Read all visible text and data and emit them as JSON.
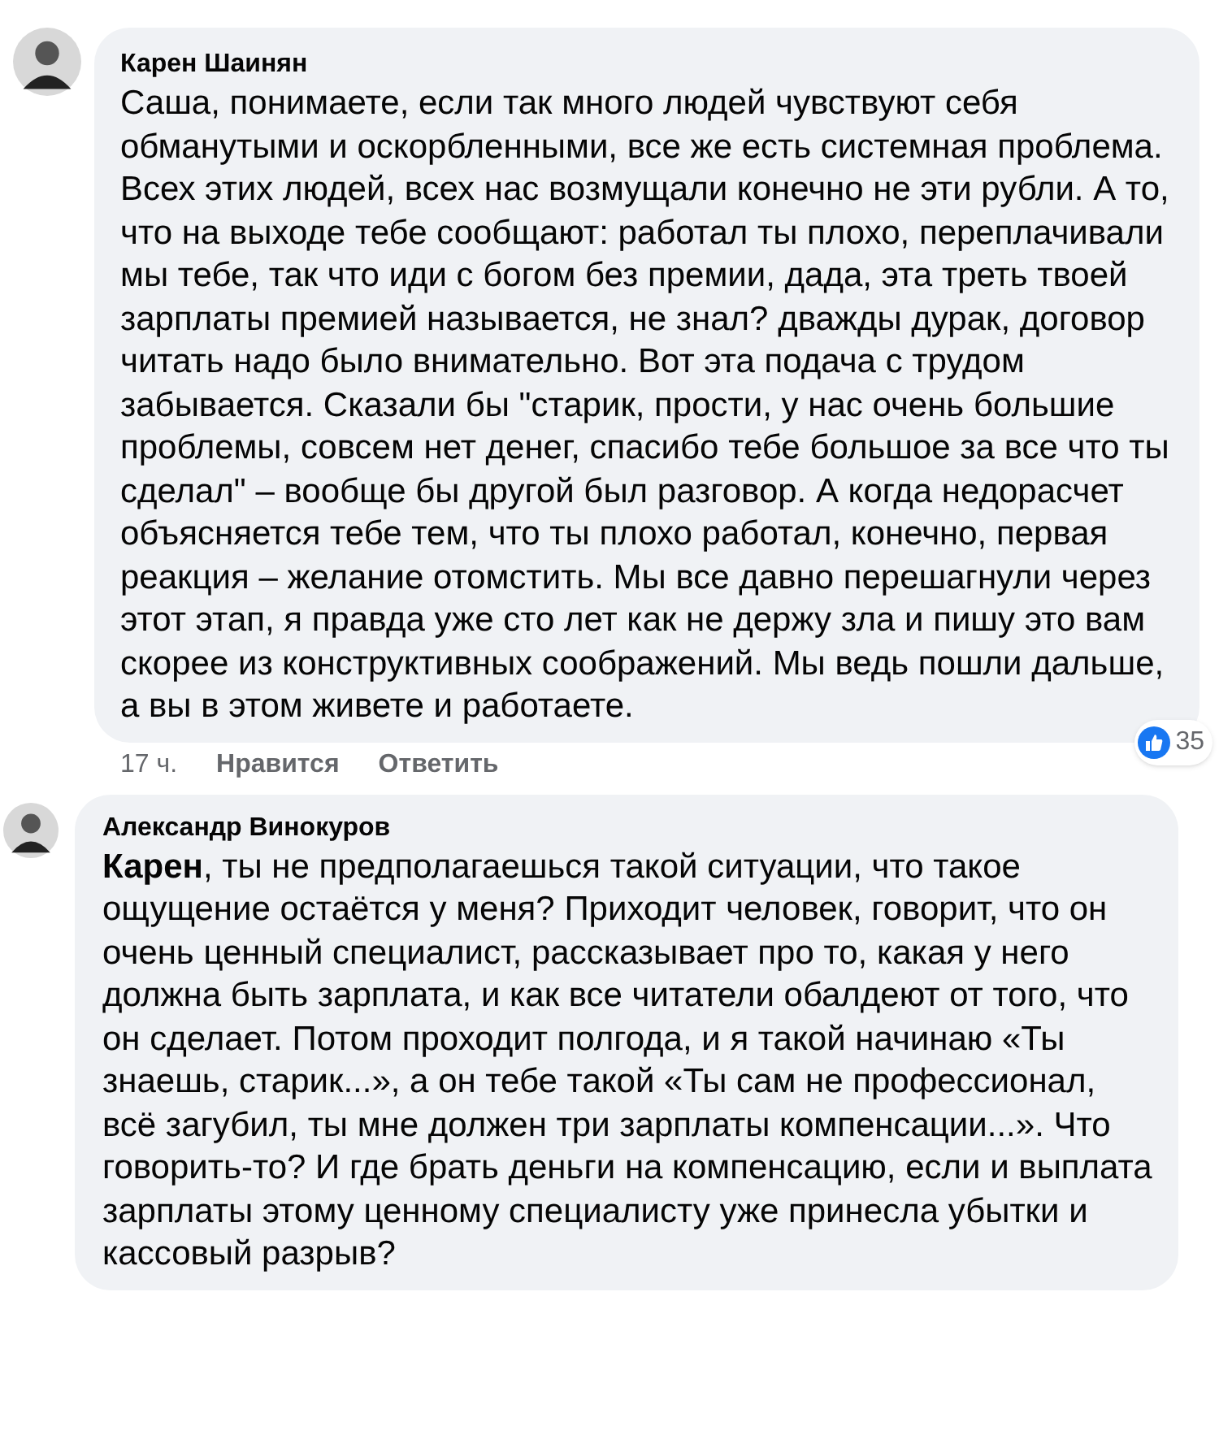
{
  "comments": [
    {
      "author": "Карен Шаинян",
      "text": "Саша, понимаете, если так много людей чувствуют себя обманутыми и оскорбленными, все же есть системная проблема. Всех этих людей, всех нас возмущали конечно не эти рубли. А то, что на выходе тебе сообщают: работал ты плохо, переплачивали мы тебе, так что иди с богом без премии, дада, эта треть твоей зарплаты премией называется, не знал? дважды дурак, договор читать надо было внимательно. Вот эта подача с трудом забывается. Сказали бы \"старик, прости, у нас очень большие проблемы, совсем нет денег, спасибо тебе большое за все что ты сделал\" – вообще бы другой был разговор. А когда недорасчет объясняется тебе тем, что ты плохо работал, конечно, первая реакция – желание отомстить. Мы все давно перешагнули через этот этап, я правда уже сто лет как не держу зла и пишу это вам скорее из конструктивных соображений. Мы ведь пошли дальше, а вы в этом живете и работаете.",
      "time": "17 ч.",
      "like": "Нравится",
      "reply": "Ответить",
      "reactions": "35"
    },
    {
      "author": "Александр Винокуров",
      "text": "**Карен**, ты не предполагаешься такой ситуации, что такое ощущение остаётся у меня? Приходит человек, говорит, что он очень ценный специалист, рассказывает про то, какая у него должна быть зарплата, и как все читатели обалдеют от того, что он сделает. Потом проходит полгода, и я такой начинаю «Ты знаешь, старик...», а он тебе такой «Ты сам не профессионал, всё загубил, ты мне должен три зарплаты компенсации...». Что говорить-то? И где брать деньги на компенсацию, если и выплата зарплаты этому ценному специалисту уже принесла убытки и кассовый разрыв?"
    }
  ]
}
